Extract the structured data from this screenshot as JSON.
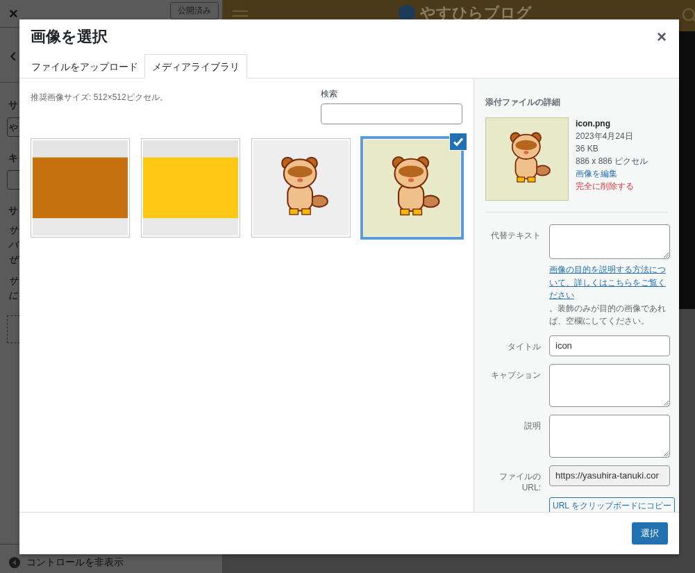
{
  "backdrop": {
    "close_symbol": "×",
    "status_button": "公開済み",
    "back_symbol": "‹",
    "sidebar_fragments": [
      {
        "kind": "heading",
        "text": "サ"
      },
      {
        "kind": "field",
        "text": "や"
      },
      {
        "kind": "heading",
        "text": "キ"
      },
      {
        "kind": "field"
      },
      {
        "kind": "heading",
        "text": "サ"
      },
      {
        "kind": "note",
        "text": "サ"
      },
      {
        "kind": "note",
        "text": "バ"
      },
      {
        "kind": "note",
        "text": "ぜ"
      },
      {
        "kind": "gap"
      },
      {
        "kind": "note",
        "text": "サ"
      },
      {
        "kind": "note",
        "text": "に"
      }
    ],
    "site_title": "やすひらブログ",
    "hide_controls": "コントロールを非表示"
  },
  "modal": {
    "title": "画像を選択",
    "close_symbol": "×",
    "tabs": [
      {
        "label": "ファイルをアップロード",
        "selected": false
      },
      {
        "label": "メディアライブラリ",
        "selected": true
      }
    ],
    "hint": "推奨画像サイズ: 512×512ピクセル。",
    "search": {
      "label": "検索"
    },
    "attachments": [
      {
        "kind": "picture",
        "selected": false
      },
      {
        "kind": "picture",
        "selected": false
      },
      {
        "kind": "picture",
        "selected": false
      },
      {
        "kind": "picture",
        "selected": true
      }
    ],
    "details": {
      "heading": "添付ファイルの詳細",
      "filename": "icon.png",
      "date": "2023年4月24日",
      "size": "36 KB",
      "dimensions": "886 x 886 ピクセル",
      "edit_link": "画像を編集",
      "delete_link": "完全に削除する",
      "fields": [
        {
          "kind": "textarea",
          "label": "代替テキスト",
          "help_link": "画像の目的を説明する方法について、詳しくはこちらをご覧ください",
          "help_text": "。装飾のみが目的の画像であれば、空欄にしてください。"
        },
        {
          "kind": "input",
          "label": "タイトル",
          "value": "icon"
        },
        {
          "kind": "textarea",
          "label": "キャプション"
        },
        {
          "kind": "textarea",
          "label": "説明"
        },
        {
          "kind": "readonly",
          "label": "ファイルの URL:",
          "value": "https://yasuhira-tanuki.cor"
        }
      ],
      "copy_button": "URL をクリップボードにコピー"
    },
    "select_button": "選択"
  }
}
